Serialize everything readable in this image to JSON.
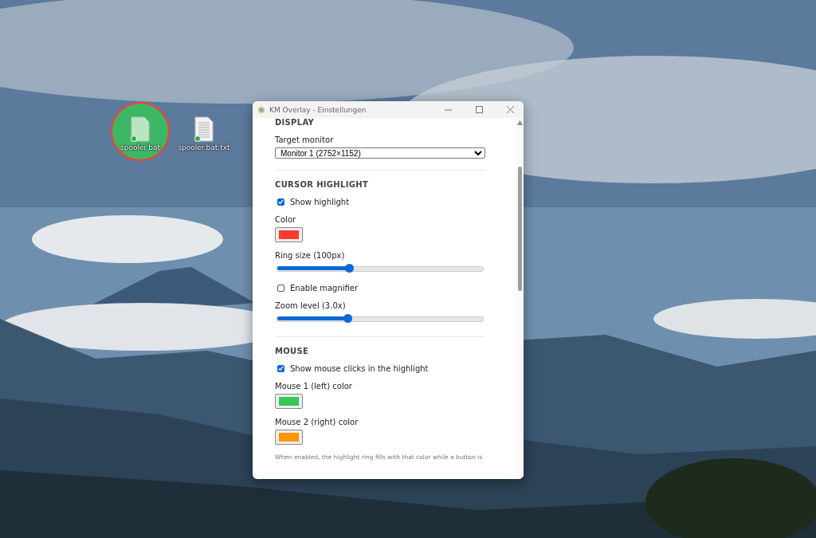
{
  "desktop_icons": [
    {
      "label": "spooler.bat",
      "highlighted": true
    },
    {
      "label": "spooler.bat.txt",
      "highlighted": false
    }
  ],
  "window": {
    "title": "KM Overlay - Einstellungen"
  },
  "sections": [
    {
      "heading": "DISPLAY",
      "items": [
        {
          "kind": "select",
          "label": "Target monitor",
          "value": "Monitor 1 (2752×1152)"
        }
      ]
    },
    {
      "heading": "CURSOR HIGHLIGHT",
      "items": [
        {
          "kind": "checkbox",
          "label": "Show highlight",
          "checked": true
        },
        {
          "kind": "color",
          "label": "Color",
          "color": "#ff3b30"
        },
        {
          "kind": "slider",
          "label": "Ring size (100px)",
          "level": 0.35
        },
        {
          "kind": "checkbox",
          "label": "Enable magnifier",
          "checked": false
        },
        {
          "kind": "slider",
          "label": "Zoom level (3.0x)",
          "level": 0.34
        }
      ]
    },
    {
      "heading": "MOUSE",
      "items": [
        {
          "kind": "checkbox",
          "label": "Show mouse clicks in the highlight",
          "checked": true
        },
        {
          "kind": "color",
          "label": "Mouse 1 (left) color",
          "color": "#34c759"
        },
        {
          "kind": "color",
          "label": "Mouse 2 (right) color",
          "color": "#ff9500"
        },
        {
          "kind": "note",
          "text": "When enabled, the highlight ring fills with that color while a button is"
        }
      ]
    }
  ]
}
